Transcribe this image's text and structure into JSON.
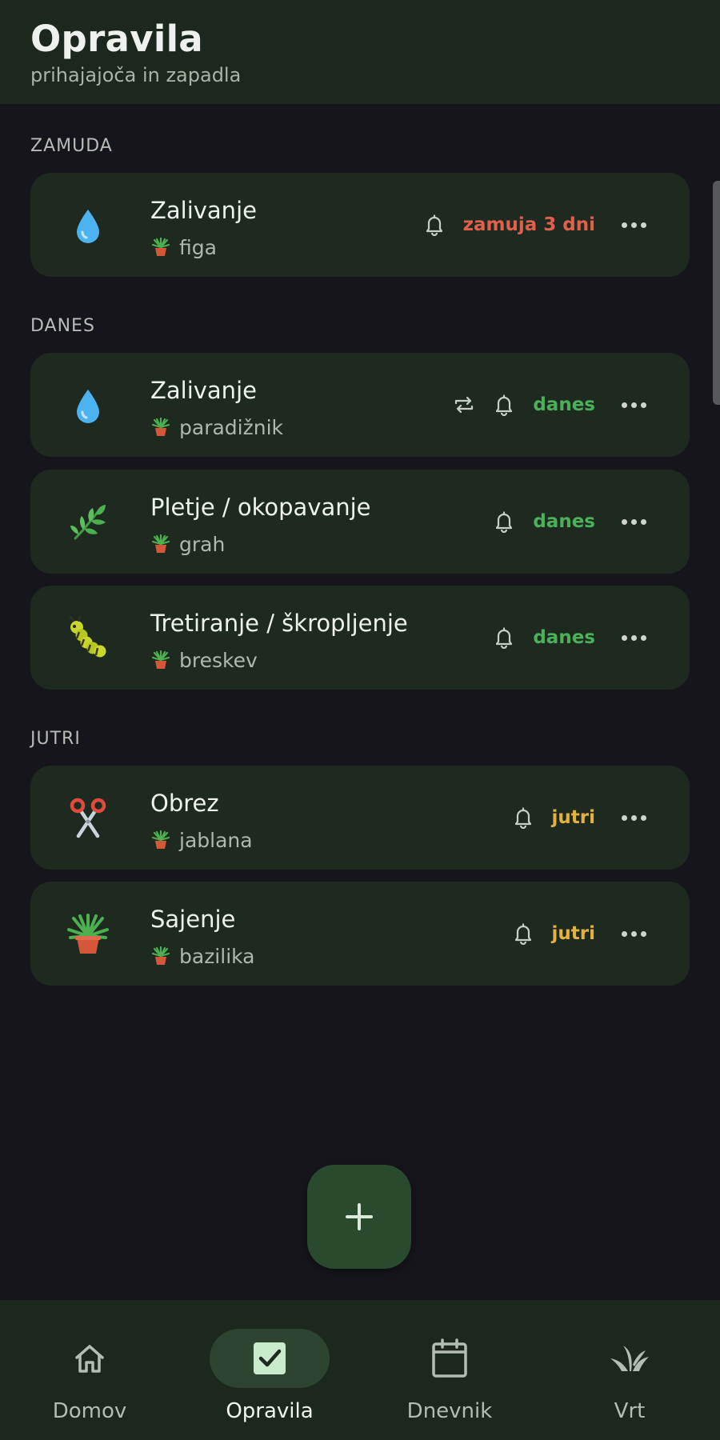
{
  "header": {
    "title": "Opravila",
    "subtitle": "prihajajoča in zapadla"
  },
  "sections": {
    "overdue": "ZAMUDA",
    "today": "DANES",
    "tomorrow": "JUTRI"
  },
  "tasks": [
    {
      "title": "Zalivanje",
      "icon": "water-drop-icon",
      "plant": "figa",
      "status": "zamuja 3 dni",
      "status_color": "#e0604c",
      "repeat": false
    },
    {
      "title": "Zalivanje",
      "icon": "water-drop-icon",
      "plant": "paradižnik",
      "status": "danes",
      "status_color": "#4caf5a",
      "repeat": true
    },
    {
      "title": "Pletje / okopavanje",
      "icon": "herb-icon",
      "plant": "grah",
      "status": "danes",
      "status_color": "#4caf5a",
      "repeat": false
    },
    {
      "title": "Tretiranje / škropljenje",
      "icon": "caterpillar-icon",
      "plant": "breskev",
      "status": "danes",
      "status_color": "#4caf5a",
      "repeat": false
    },
    {
      "title": "Obrez",
      "icon": "scissors-icon",
      "plant": "jablana",
      "status": "jutri",
      "status_color": "#e3b23c",
      "repeat": false
    },
    {
      "title": "Sajenje",
      "icon": "potted-plant-icon",
      "plant": "bazilika",
      "status": "jutri",
      "status_color": "#e3b23c",
      "repeat": false
    }
  ],
  "fab": {
    "icon": "plus-icon"
  },
  "nav": [
    {
      "label": "Domov",
      "icon": "home-icon",
      "active": false
    },
    {
      "label": "Opravila",
      "icon": "checkbox-icon",
      "active": true
    },
    {
      "label": "Dnevnik",
      "icon": "calendar-icon",
      "active": false
    },
    {
      "label": "Vrt",
      "icon": "garden-icon",
      "active": false
    }
  ],
  "colors": {
    "background": "#15151b",
    "card": "#1e2a1f",
    "header": "#1c281d",
    "overdue": "#e0604c",
    "today": "#4caf5a",
    "tomorrow": "#e3b23c"
  }
}
